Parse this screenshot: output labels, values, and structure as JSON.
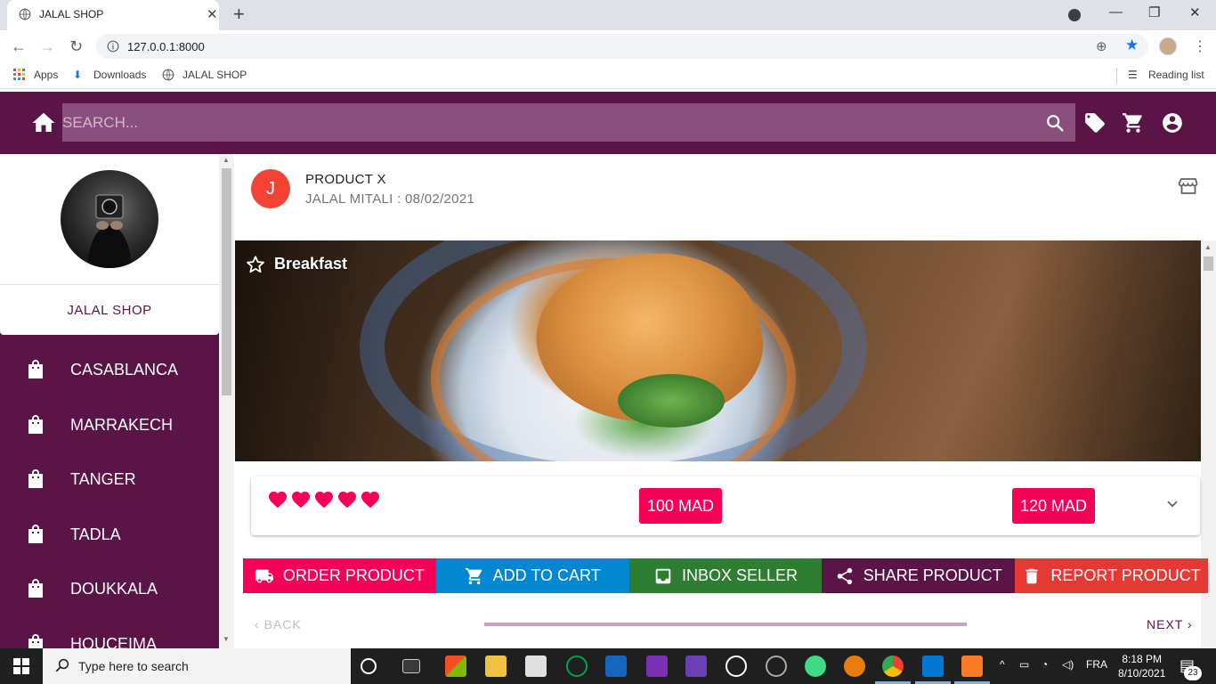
{
  "browser": {
    "tab_title": "JALAL SHOP",
    "url": "127.0.0.1:8000",
    "bookmarks": [
      "Apps",
      "Downloads",
      "JALAL SHOP"
    ],
    "reading_list": "Reading list"
  },
  "header": {
    "search_placeholder": "SEARCH..."
  },
  "sidebar": {
    "shop_name": "JALAL SHOP",
    "cities": [
      "CASABLANCA",
      "MARRAKECH",
      "TANGER",
      "TADLA",
      "DOUKKALA",
      "HOUCEIMA"
    ]
  },
  "product": {
    "avatar_letter": "J",
    "title": "PRODUCT X",
    "subtitle": "JALAL MITALI : 08/02/2021",
    "image_title": "Breakfast",
    "rating": 5,
    "price_1": "100 MAD",
    "price_2": "120 MAD"
  },
  "actions": {
    "order": "ORDER PRODUCT",
    "cart": "ADD TO CART",
    "inbox": "INBOX SELLER",
    "share": "SHARE PRODUCT",
    "report": "REPORT PRODUCT"
  },
  "stepper": {
    "back": "BACK",
    "next": "NEXT"
  },
  "taskbar": {
    "search_placeholder": "Type here to search",
    "lang": "FRA",
    "time": "8:18 PM",
    "date": "8/10/2021",
    "notifications": "23"
  },
  "colors": {
    "brand": "#5b1447",
    "accent": "#f50057",
    "order": "#f50057",
    "cart": "#0288d1",
    "inbox": "#2e7d32",
    "share": "#5b1447",
    "report": "#e53935"
  }
}
